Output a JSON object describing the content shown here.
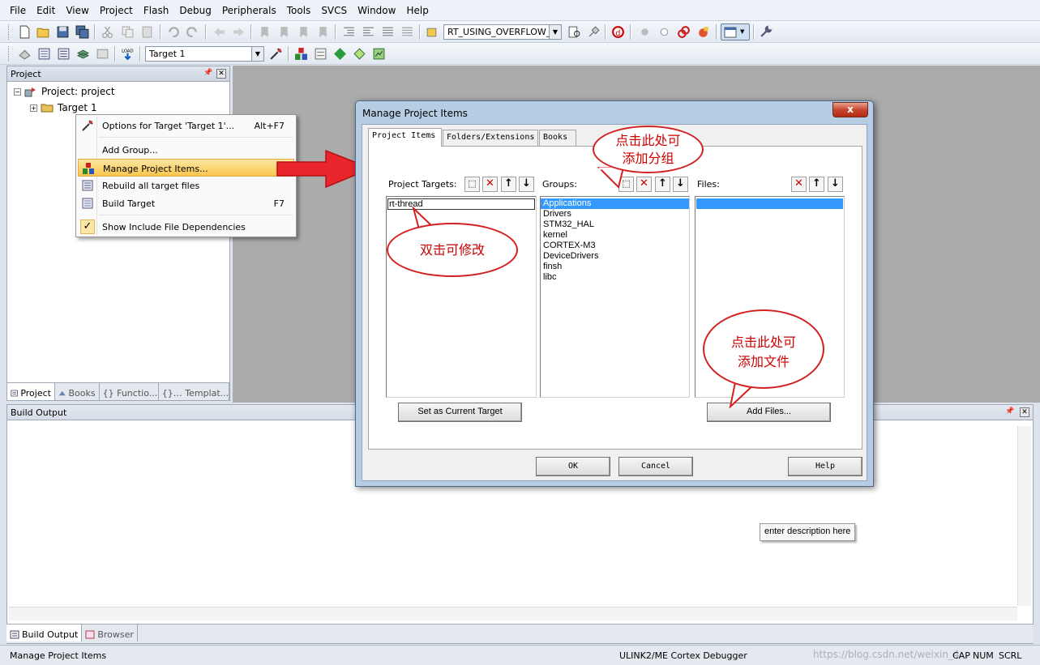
{
  "menu": [
    "File",
    "Edit",
    "View",
    "Project",
    "Flash",
    "Debug",
    "Peripherals",
    "Tools",
    "SVCS",
    "Window",
    "Help"
  ],
  "toolbar": {
    "config_combo": "RT_USING_OVERFLOW_C",
    "target_combo": "Target 1"
  },
  "project_panel": {
    "title": "Project",
    "root": "Project: project",
    "target": "Target 1",
    "tabs": [
      "Project",
      "Books",
      "{} Functio...",
      "{}… Templat..."
    ]
  },
  "context_menu": {
    "options": "Options for Target 'Target 1'...",
    "options_accel": "Alt+F7",
    "add_group": "Add Group...",
    "manage": "Manage Project Items...",
    "rebuild": "Rebuild all target files",
    "build": "Build Target",
    "build_accel": "F7",
    "show_deps": "Show Include File Dependencies"
  },
  "build_output": {
    "title": "Build Output",
    "tabs": [
      "Build Output",
      "Browser"
    ]
  },
  "dialog": {
    "title": "Manage Project Items",
    "close": "x",
    "tabs": [
      "Project Items",
      "Folders/Extensions",
      "Books"
    ],
    "targets_label": "Project Targets:",
    "groups_label": "Groups:",
    "files_label": "Files:",
    "target_value": "rt-thread",
    "groups": [
      "Applications",
      "Drivers",
      "STM32_HAL",
      "kernel",
      "CORTEX-M3",
      "DeviceDrivers",
      "finsh",
      "libc"
    ],
    "set_current": "Set as Current Target",
    "add_files": "Add Files...",
    "ok": "OK",
    "cancel": "Cancel",
    "help": "Help"
  },
  "callouts": {
    "group": [
      "点击此处可",
      "添加分组"
    ],
    "edit": "双击可修改",
    "file": [
      "点击此处可",
      "添加文件"
    ]
  },
  "tooltip": "enter description here",
  "status": {
    "left": "Manage Project Items",
    "debugger": "ULINK2/ME Cortex Debugger",
    "watermark": "https://blog.csdn.net/weixin_4...",
    "caps": "CAP",
    "num": "NUM",
    "scrl": "SCRL"
  },
  "colors": {
    "accent_arrow": "#e8262b",
    "callout_border": "#d32020",
    "selection": "#3399ff"
  }
}
